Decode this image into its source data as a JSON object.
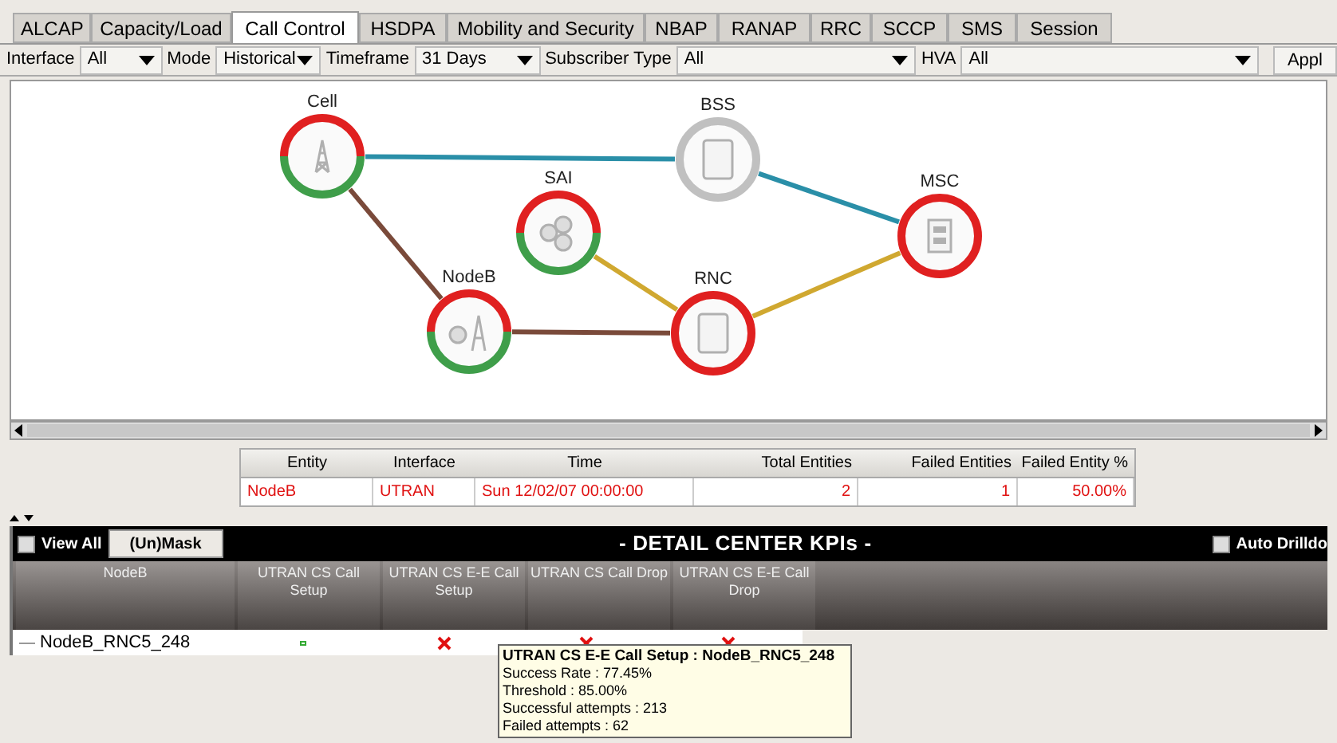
{
  "tabs": [
    {
      "label": "ALCAP",
      "selected": false
    },
    {
      "label": "Capacity/Load",
      "selected": false
    },
    {
      "label": "Call Control",
      "selected": true
    },
    {
      "label": "HSDPA",
      "selected": false
    },
    {
      "label": "Mobility and Security",
      "selected": false
    },
    {
      "label": "NBAP",
      "selected": false
    },
    {
      "label": "RANAP",
      "selected": false
    },
    {
      "label": "RRC",
      "selected": false
    },
    {
      "label": "SCCP",
      "selected": false
    },
    {
      "label": "SMS",
      "selected": false
    },
    {
      "label": "Session",
      "selected": false
    }
  ],
  "filters": [
    {
      "label": "Interface",
      "value": "All"
    },
    {
      "label": "Mode",
      "value": "Historical"
    },
    {
      "label": "Timeframe",
      "value": "31 Days"
    },
    {
      "label": "Subscriber Type",
      "value": "All"
    },
    {
      "label": "HVA",
      "value": "All"
    }
  ],
  "apply_button": "Appl",
  "diagram": {
    "nodes": [
      {
        "label": "Cell",
        "kind": "partial"
      },
      {
        "label": "BSS",
        "kind": "unknown"
      },
      {
        "label": "SAI",
        "kind": "partial"
      },
      {
        "label": "NodeB",
        "kind": "partial"
      },
      {
        "label": "RNC",
        "kind": "down"
      },
      {
        "label": "MSC",
        "kind": "down"
      }
    ],
    "links": [
      {
        "color": "#2a8fa8"
      },
      {
        "color": "#2a8fa8"
      },
      {
        "color": "#7a4a3a"
      },
      {
        "color": "#7a4a3a"
      },
      {
        "color": "#d0a830"
      },
      {
        "color": "#d0a830"
      }
    ]
  },
  "entity_table": {
    "columns": [
      "Entity",
      "Interface",
      "Time",
      "Total Entities",
      "Failed Entities",
      "Failed Entity %"
    ],
    "rows": [
      [
        "NodeB",
        "UTRAN",
        "Sun 12/02/07 00:00:00",
        "2",
        "1",
        "50.00%"
      ]
    ]
  },
  "kpi_panel": {
    "view_all": {
      "label": "View All",
      "checked": false
    },
    "mask_button": "(Un)Mask",
    "title": "- DETAIL CENTER KPIs -",
    "auto_drilldown": {
      "label": "Auto Drilldo",
      "checked": false
    },
    "columns": [
      "NodeB",
      "UTRAN CS Call Setup",
      "UTRAN CS E-E Call Setup",
      "UTRAN CS Call Drop",
      "UTRAN CS E-E Call Drop"
    ],
    "rows": [
      {
        "name": "NodeB_RNC5_248",
        "cells": [
          {
            "kind": "ok"
          },
          {
            "kind": "fail"
          },
          {
            "kind": "fail"
          },
          {
            "kind": "fail"
          }
        ]
      }
    ]
  },
  "tooltip": {
    "title": "UTRAN CS E-E Call Setup : NodeB_RNC5_248",
    "lines": [
      "Success Rate : 77.45%",
      "Threshold : 85.00%",
      "Successful attempts : 213",
      "Failed attempts : 62"
    ]
  }
}
